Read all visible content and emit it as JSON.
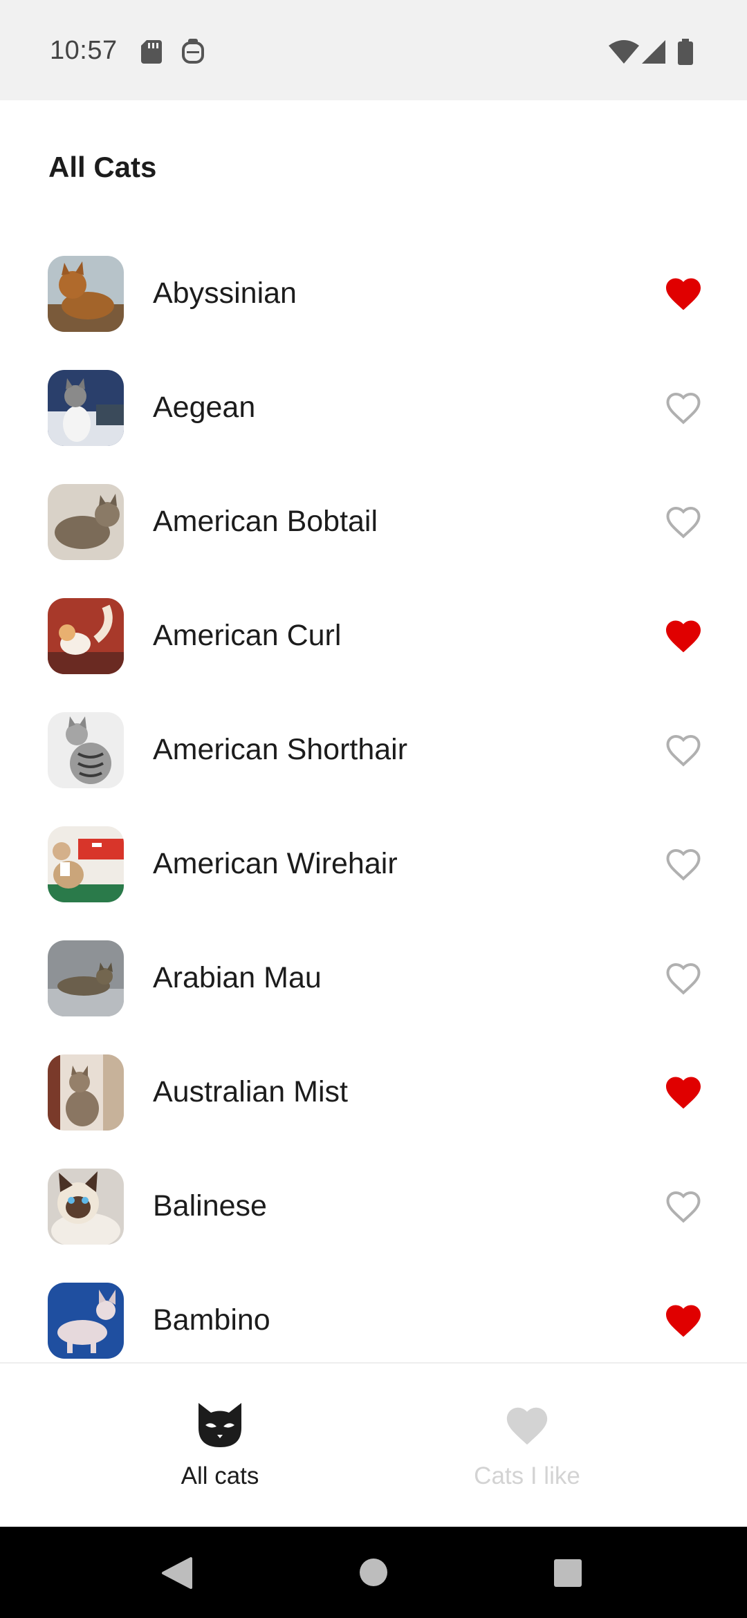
{
  "status_bar": {
    "time": "10:57",
    "icons": [
      "sd-card-icon",
      "assistant-icon",
      "wifi-icon",
      "cellular-signal-icon",
      "battery-icon"
    ]
  },
  "page": {
    "title": "All Cats"
  },
  "cats": [
    {
      "name": "Abyssinian",
      "favorite": true
    },
    {
      "name": "Aegean",
      "favorite": false
    },
    {
      "name": "American Bobtail",
      "favorite": false
    },
    {
      "name": "American Curl",
      "favorite": true
    },
    {
      "name": "American Shorthair",
      "favorite": false
    },
    {
      "name": "American Wirehair",
      "favorite": false
    },
    {
      "name": "Arabian Mau",
      "favorite": false
    },
    {
      "name": "Australian Mist",
      "favorite": true
    },
    {
      "name": "Balinese",
      "favorite": false
    },
    {
      "name": "Bambino",
      "favorite": true
    }
  ],
  "bottom_nav": {
    "items": [
      {
        "label": "All cats",
        "icon": "cat-face-icon",
        "active": true
      },
      {
        "label": "Cats I like",
        "icon": "heart-icon",
        "active": false
      }
    ]
  },
  "colors": {
    "favorite_red": "#e00000",
    "heart_outline": "#b0b0b0",
    "nav_active": "#1c1c1c",
    "nav_inactive": "#d3d3d3"
  }
}
